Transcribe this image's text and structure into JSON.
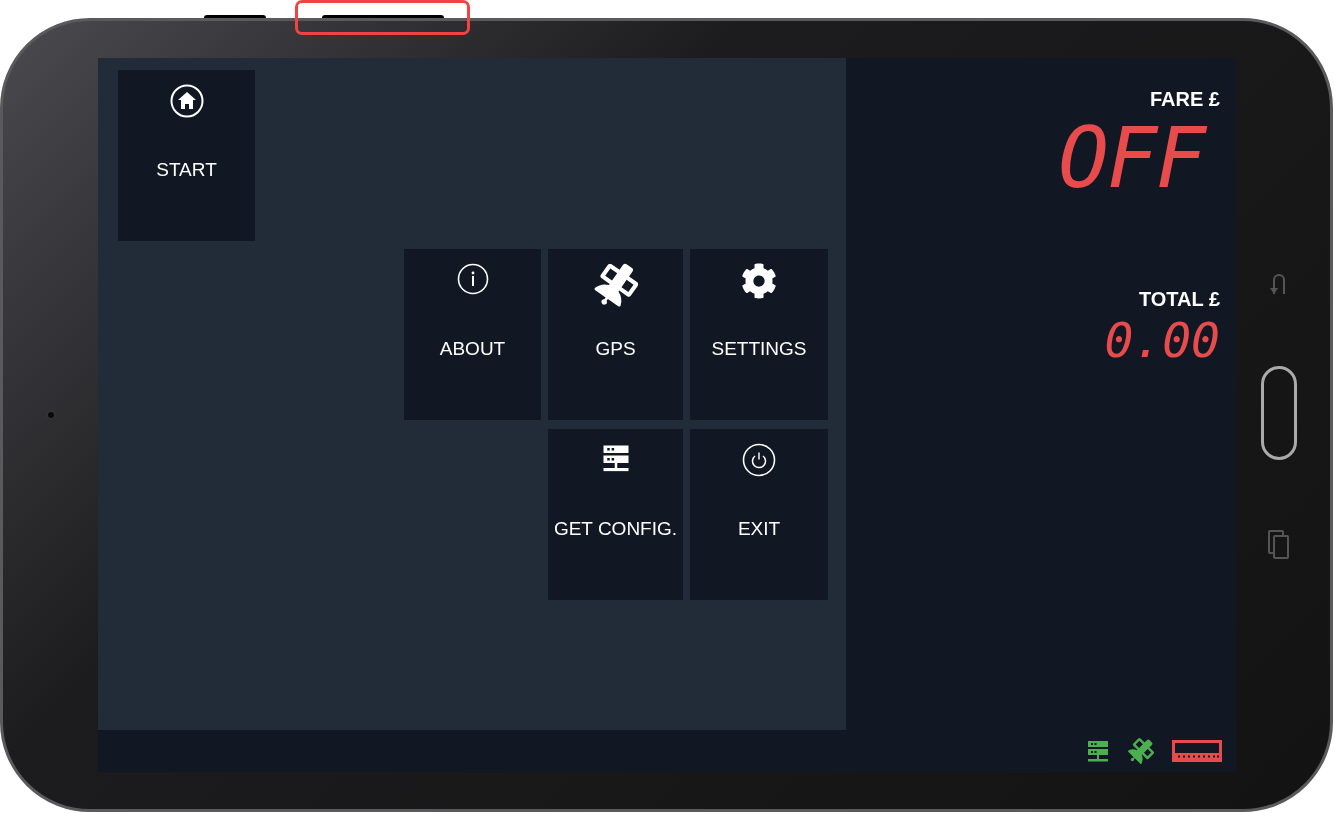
{
  "start_tile": {
    "label": "START",
    "kind": "start"
  },
  "menu": {
    "rows": [
      [
        {
          "label": "ABOUT",
          "kind": "about"
        },
        {
          "label": "GPS",
          "kind": "gps"
        },
        {
          "label": "SETTINGS",
          "kind": "settings"
        }
      ],
      [
        "",
        {
          "label": "GET CONFIG.",
          "kind": "config"
        },
        {
          "label": "EXIT",
          "kind": "exit"
        }
      ]
    ]
  },
  "meter": {
    "fare_label": "FARE £",
    "fare_value": "OFF",
    "total_label": "TOTAL £",
    "total_value": "0.00"
  },
  "status_bar": [
    {
      "kind": "server",
      "color": "#4caf50"
    },
    {
      "kind": "gps",
      "color": "#4caf50"
    },
    {
      "kind": "meter",
      "color": "#e84b4b"
    }
  ]
}
